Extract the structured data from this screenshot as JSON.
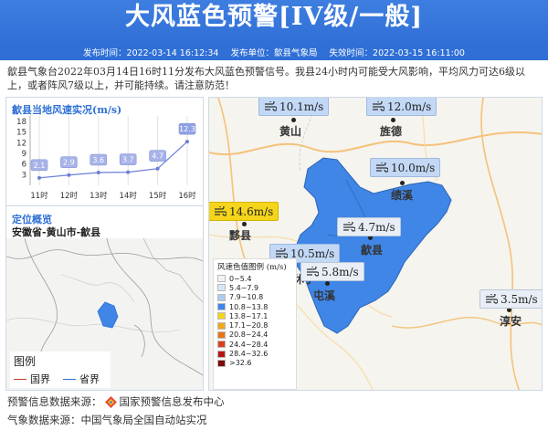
{
  "header": {
    "title": "大风蓝色预警[IV级/一般]",
    "publish_time": "发布时间：2022-03-14 16:12:34",
    "publisher": "发布单位：歙县气象局",
    "expire_time": "失效时间：2022-03-15 16:11:00"
  },
  "description": "歙县气象台2022年03月14日16时11分发布大风蓝色预警信号。我县24小时内可能受大风影响，平均风力可达6级以上，或者阵风7级以上，并可能持续。请注意防范！",
  "wind_chart": {
    "title": "歙县当地风速实况(m/s)"
  },
  "chart_data": {
    "type": "line",
    "title": "歙县当地风速实况(m/s)",
    "categories": [
      "11时",
      "12时",
      "13时",
      "14时",
      "15时",
      "16时"
    ],
    "values": [
      2.1,
      2.9,
      3.6,
      3.7,
      4.7,
      12.3
    ],
    "y_ticks": [
      "3",
      "6",
      "9",
      "12",
      "15",
      "18"
    ],
    "ylim": [
      0,
      18
    ],
    "grid": true
  },
  "location": {
    "title": "定位概览",
    "path": "安徽省-黄山市-歙县"
  },
  "minimap_legend": {
    "title": "图例",
    "items": [
      {
        "label": "国界",
        "color": "#c0392b"
      },
      {
        "label": "省界",
        "color": "#2f6fd6"
      }
    ]
  },
  "map": {
    "places": [
      "黄山",
      "旌德",
      "绩溪",
      "黟县",
      "歙县",
      "休宁",
      "屯溪",
      "淳安"
    ],
    "stations": [
      {
        "value": "10.1m/s",
        "style": "blue"
      },
      {
        "value": "12.0m/s",
        "style": "blue"
      },
      {
        "value": "10.0m/s",
        "style": "blue"
      },
      {
        "value": "14.6m/s",
        "style": "yellow"
      },
      {
        "value": "4.7m/s",
        "style": "white"
      },
      {
        "value": "10.5m/s",
        "style": "blue"
      },
      {
        "value": "5.8m/s",
        "style": "white"
      },
      {
        "value": "3.5m/s",
        "style": "white"
      }
    ],
    "legend_title": "风速色值图例 (m/s)",
    "legend": [
      {
        "label": "0~5.4",
        "color": "#f2f2f2"
      },
      {
        "label": "5.4~7.9",
        "color": "#d6e7f8"
      },
      {
        "label": "7.9~10.8",
        "color": "#a9cdf3"
      },
      {
        "label": "10.8~13.8",
        "color": "#3f86e6"
      },
      {
        "label": "13.8~17.1",
        "color": "#f5d51b"
      },
      {
        "label": "17.1~20.8",
        "color": "#f2a81d"
      },
      {
        "label": "20.8~24.4",
        "color": "#e8731a"
      },
      {
        "label": "24.4~28.4",
        "color": "#d9401a"
      },
      {
        "label": "28.4~32.6",
        "color": "#b5170f"
      },
      {
        "label": ">32.6",
        "color": "#7a0a0a"
      }
    ]
  },
  "footer": {
    "warning_source_label": "预警信息数据来源：",
    "warning_source": "国家预警信息发布中心",
    "weather_source": "气象数据来源：中国气象局全国自动站实况"
  }
}
